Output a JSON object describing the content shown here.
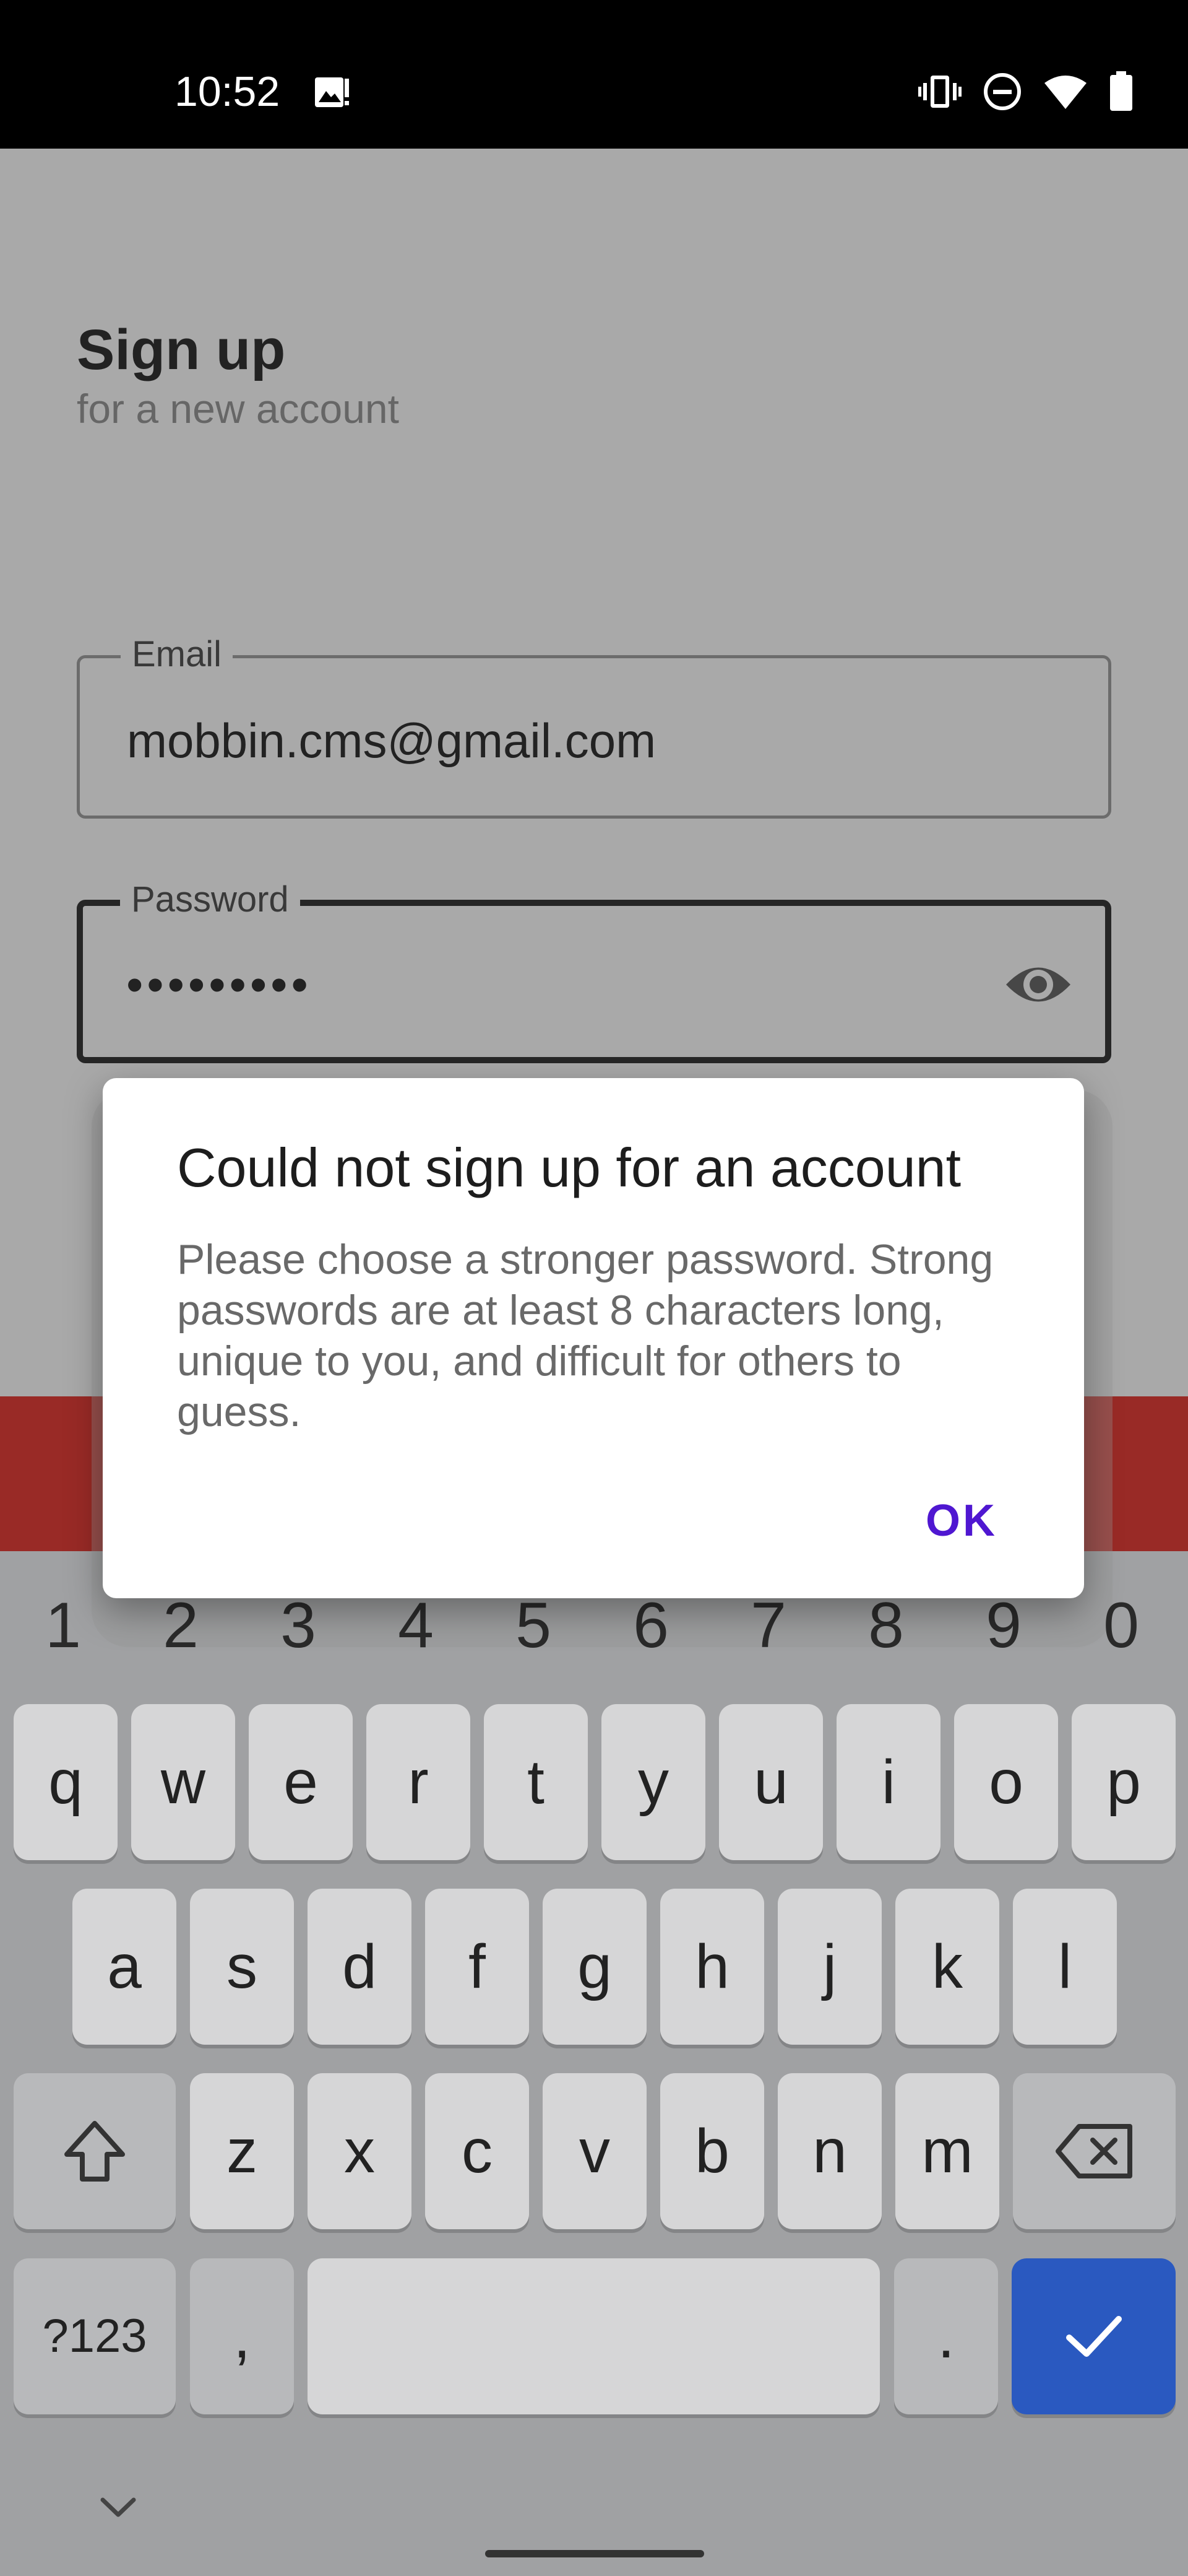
{
  "status_bar": {
    "time": "10:52",
    "icons": [
      "image-notification-icon",
      "vibrate-icon",
      "do-not-disturb-icon",
      "wifi-icon",
      "battery-icon"
    ]
  },
  "signup": {
    "title": "Sign up",
    "subtitle": "for a new account",
    "email": {
      "label": "Email",
      "value": "mobbin.cms@gmail.com"
    },
    "password": {
      "label": "Password",
      "value": "•••••••••"
    }
  },
  "dialog": {
    "title": "Could not sign up for an account",
    "message": "Please choose a stronger password. Strong passwords are at least 8 characters long, unique to you, and difficult for others to guess.",
    "ok_label": "OK"
  },
  "keyboard": {
    "number_row": [
      "1",
      "2",
      "3",
      "4",
      "5",
      "6",
      "7",
      "8",
      "9",
      "0"
    ],
    "row1": [
      "q",
      "w",
      "e",
      "r",
      "t",
      "y",
      "u",
      "i",
      "o",
      "p"
    ],
    "row2": [
      "a",
      "s",
      "d",
      "f",
      "g",
      "h",
      "j",
      "k",
      "l"
    ],
    "row3": [
      "z",
      "x",
      "c",
      "v",
      "b",
      "n",
      "m"
    ],
    "symbols_label": "?123",
    "comma": ",",
    "period": "."
  },
  "colors": {
    "primary_button": "#992a26",
    "dialog_accent": "#4f17d1",
    "enter_key": "#2a59c0"
  }
}
